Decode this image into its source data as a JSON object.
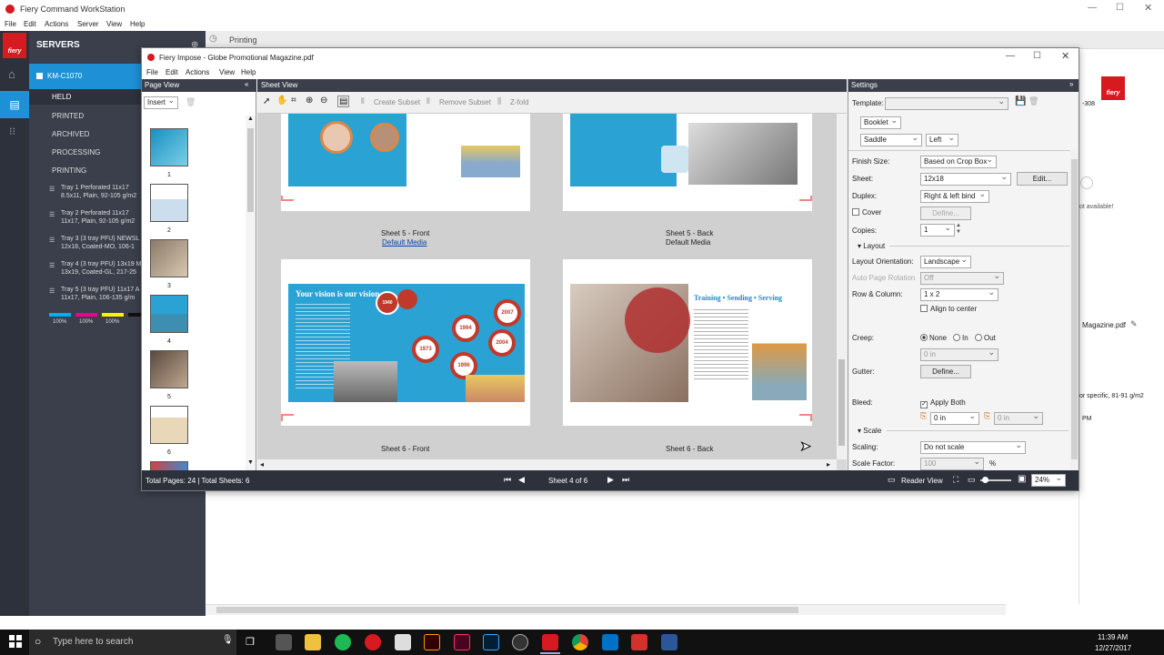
{
  "bg": {
    "title": "Fiery Command WorkStation",
    "menu": [
      "File",
      "Edit",
      "Actions",
      "Server",
      "View",
      "Help"
    ],
    "servers_label": "SERVERS",
    "server_name": "KM-C1070",
    "queues": [
      "HELD",
      "PRINTED",
      "ARCHIVED",
      "PROCESSING",
      "PRINTING"
    ],
    "trays": [
      [
        "Tray 1 Perforated 11x17",
        "8.5x11, Plain, 92-105 g/m2"
      ],
      [
        "Tray 2 Perforated 11x17",
        "11x17, Plain, 92-105 g/m2"
      ],
      [
        "Tray 3 (3 tray PFU) NEWSL",
        "12x18, Coated-MO, 106-1"
      ],
      [
        "Tray 4 (3 tray PFU) 13x19 M",
        "13x19, Coated-GL, 217-25"
      ],
      [
        "Tray 5 (3 tray PFU) 11x17 A",
        "11x17, Plain, 106-135 g/m"
      ]
    ],
    "toner": [
      "100%",
      "100%",
      "100%",
      "100%"
    ],
    "printing": "Printing",
    "right_frag": {
      "model": "-308",
      "not_avail": "ot available!",
      "magazine": "Magazine.pdf",
      "specific": "or specific, 81-91 g/m2",
      "pm": "PM"
    }
  },
  "win": {
    "title": "Fiery Impose - Globe Promotional Magazine.pdf",
    "menu": [
      "File",
      "Edit",
      "Actions",
      "View",
      "Help"
    ]
  },
  "page_view": {
    "header": "Page View",
    "insert": "Insert",
    "pages": [
      "1",
      "2",
      "3",
      "4",
      "5",
      "6"
    ]
  },
  "sheet_view": {
    "header": "Sheet View",
    "tools": {
      "create": "Create Subset",
      "remove": "Remove Subset",
      "zfold": "Z-fold"
    },
    "sheet5_front": "Sheet 5 - Front",
    "sheet5_front_media": "Default Media",
    "sheet5_back": "Sheet 5 - Back",
    "sheet5_back_media": "Default Media",
    "sheet6_front": "Sheet 6 - Front",
    "sheet6_back": "Sheet 6 - Back",
    "vision_title": "Your vision is our vision",
    "training_title": "Training • Sending • Serving",
    "years": [
      "2007",
      "1994",
      "1973",
      "1996",
      "2004",
      "1940"
    ]
  },
  "status": {
    "totals": "Total Pages: 24 | Total Sheets: 6",
    "sheet_nav": "Sheet 4 of 6",
    "reader_view": "Reader View",
    "zoom": "24%"
  },
  "settings": {
    "header": "Settings",
    "template_label": "Template:",
    "template_value": "",
    "booklet": "Booklet",
    "saddle": "Saddle",
    "left": "Left",
    "finish_label": "Finish Size:",
    "finish_value": "Based on Crop Box",
    "sheet_label": "Sheet:",
    "sheet_value": "12x18",
    "edit_btn": "Edit...",
    "duplex_label": "Duplex:",
    "duplex_value": "Right & left bind",
    "cover_label": "Cover",
    "define_btn": "Define...",
    "copies_label": "Copies:",
    "copies_value": "1",
    "layout_section": "Layout",
    "orient_label": "Layout Orientation:",
    "orient_value": "Landscape",
    "autorot_label": "Auto Page Rotation",
    "autorot_value": "Off",
    "rowcol_label": "Row & Column:",
    "rowcol_value": "1 x 2",
    "align_label": "Align to center",
    "creep_label": "Creep:",
    "creep_opts": [
      "None",
      "In",
      "Out"
    ],
    "creep_value": "0 in",
    "gutter_label": "Gutter:",
    "gutter_btn": "Define...",
    "bleed_label": "Bleed:",
    "apply_both": "Apply Both",
    "bleed_v1": "0 in",
    "bleed_v2": "0 in",
    "scale_section": "Scale",
    "scaling_label": "Scaling:",
    "scaling_value": "Do not scale",
    "scalefactor_label": "Scale Factor:",
    "scalefactor_value": "100",
    "pct": "%"
  },
  "taskbar": {
    "search": "Type here to search",
    "time": "11:39 AM",
    "date": "12/27/2017"
  },
  "colors": {
    "accent": "#1e90d6",
    "sidebar": "#3a3f4b",
    "sidebar2": "#2c313b",
    "fiery_red": "#d71920",
    "blue_art": "#2aa3d4"
  }
}
